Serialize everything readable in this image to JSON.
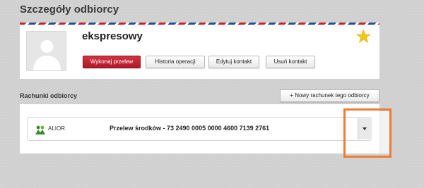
{
  "page": {
    "title": "Szczegóły odbiorcy"
  },
  "recipient": {
    "name": "ekspresowy",
    "actions": {
      "transfer": "Wykonaj przelew",
      "history": "Historia operacji",
      "edit": "Edytuj kontakt",
      "delete": "Usuń kontakt"
    }
  },
  "accounts": {
    "section_label": "Rachunki odbiorcy",
    "new_button": "+ Nowy rachunek tego odbiorcy",
    "items": [
      {
        "bank": "ALIOR",
        "description": "Przelew środków - 73 2490 0005 0000 4600 7139 2761"
      }
    ]
  },
  "colors": {
    "primary_button": "#c0202e",
    "star": "#f5c518",
    "highlight": "#f07b35",
    "bank_logo": "#3a8a2a"
  },
  "icons": {
    "avatar": "user-silhouette-icon",
    "favorite": "star-icon",
    "bank": "alior-logo-icon",
    "dropdown": "chevron-down-icon"
  }
}
